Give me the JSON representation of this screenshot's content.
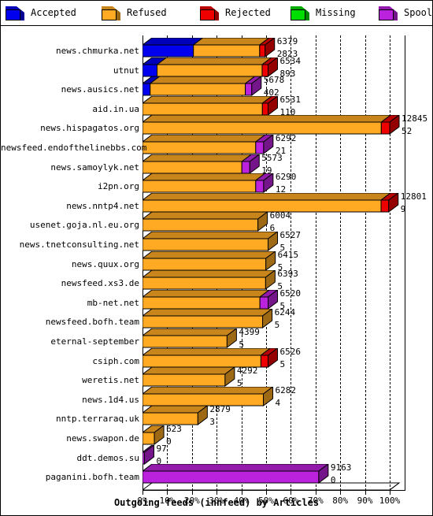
{
  "legend": {
    "items": [
      {
        "label": "Accepted",
        "color": "#0000ee",
        "icon": "cube-icon"
      },
      {
        "label": "Refused",
        "color": "#ffaa22",
        "icon": "cube-icon"
      },
      {
        "label": "Rejected",
        "color": "#ee0000",
        "icon": "cube-icon"
      },
      {
        "label": "Missing",
        "color": "#00dd00",
        "icon": "cube-icon"
      },
      {
        "label": "Spooled",
        "color": "#bb22dd",
        "icon": "cube-icon"
      }
    ]
  },
  "chart_data": {
    "type": "bar",
    "orientation": "horizontal",
    "stacked": true,
    "title": "Outgoing feeds (innfeed) by Articles",
    "xlabel": "Outgoing feeds (innfeed) by Articles",
    "ylabel": "",
    "xlim": [
      0,
      100
    ],
    "xunit": "%",
    "grid": true,
    "legend_position": "top",
    "xticks": [
      "0%",
      "10%",
      "20%",
      "30%",
      "40%",
      "50%",
      "60%",
      "70%",
      "80%",
      "90%",
      "100%"
    ],
    "xtick_values": [
      0,
      10,
      20,
      30,
      40,
      50,
      60,
      70,
      80,
      90,
      100
    ],
    "series": [
      {
        "name": "Accepted",
        "color": "#0000ee"
      },
      {
        "name": "Refused",
        "color": "#ffaa22"
      },
      {
        "name": "Rejected",
        "color": "#ee0000"
      },
      {
        "name": "Missing",
        "color": "#00dd00"
      },
      {
        "name": "Spooled",
        "color": "#bb22dd"
      }
    ],
    "categories": [
      "news.chmurka.net",
      "utnut",
      "news.ausics.net",
      "aid.in.ua",
      "news.hispagatos.org",
      "newsfeed.endofthelinebbs.com",
      "news.samoylyk.net",
      "i2pn.org",
      "news.nntp4.net",
      "usenet.goja.nl.eu.org",
      "news.tnetconsulting.net",
      "news.quux.org",
      "newsfeed.xs3.de",
      "mb-net.net",
      "newsfeed.bofh.team",
      "eternal-september",
      "csiph.com",
      "weretis.net",
      "news.1d4.us",
      "nntp.terraraq.uk",
      "news.swapon.de",
      "ddt.demos.su",
      "paganini.bofh.team"
    ],
    "rows": [
      {
        "label": "news.chmurka.net",
        "top_value": "6379",
        "bottom_value": "2823",
        "total_pct": 49.6,
        "segments": [
          {
            "series": "Accepted",
            "pct": 20.6
          },
          {
            "series": "Refused",
            "pct": 26.8
          },
          {
            "series": "Rejected",
            "pct": 2.2
          }
        ]
      },
      {
        "label": "utnut",
        "top_value": "6534",
        "bottom_value": "893",
        "total_pct": 50.8,
        "segments": [
          {
            "series": "Accepted",
            "pct": 5.9
          },
          {
            "series": "Refused",
            "pct": 42.5
          },
          {
            "series": "Rejected",
            "pct": 2.4
          }
        ]
      },
      {
        "label": "news.ausics.net",
        "top_value": "5678",
        "bottom_value": "402",
        "total_pct": 44.2,
        "segments": [
          {
            "series": "Accepted",
            "pct": 3.1
          },
          {
            "series": "Refused",
            "pct": 38.5
          },
          {
            "series": "Spooled",
            "pct": 2.6
          }
        ]
      },
      {
        "label": "aid.in.ua",
        "top_value": "6531",
        "bottom_value": "110",
        "total_pct": 50.8,
        "segments": [
          {
            "series": "Refused",
            "pct": 48.5
          },
          {
            "series": "Rejected",
            "pct": 2.3
          }
        ]
      },
      {
        "label": "news.hispagatos.org",
        "top_value": "12845",
        "bottom_value": "52",
        "total_pct": 100.0,
        "segments": [
          {
            "series": "Refused",
            "pct": 96.6
          },
          {
            "series": "Rejected",
            "pct": 3.4
          }
        ]
      },
      {
        "label": "newsfeed.endofthelinebbs.com",
        "top_value": "6292",
        "bottom_value": "21",
        "total_pct": 49.0,
        "segments": [
          {
            "series": "Refused",
            "pct": 45.8
          },
          {
            "series": "Spooled",
            "pct": 3.2
          }
        ]
      },
      {
        "label": "news.samoylyk.net",
        "top_value": "5573",
        "bottom_value": "19",
        "total_pct": 43.4,
        "segments": [
          {
            "series": "Refused",
            "pct": 40.2
          },
          {
            "series": "Spooled",
            "pct": 3.2
          }
        ]
      },
      {
        "label": "i2pn.org",
        "top_value": "6290",
        "bottom_value": "12",
        "total_pct": 49.0,
        "segments": [
          {
            "series": "Refused",
            "pct": 45.8
          },
          {
            "series": "Spooled",
            "pct": 3.2
          }
        ]
      },
      {
        "label": "news.nntp4.net",
        "top_value": "12801",
        "bottom_value": "9",
        "total_pct": 99.6,
        "segments": [
          {
            "series": "Refused",
            "pct": 96.5
          },
          {
            "series": "Rejected",
            "pct": 3.1
          }
        ]
      },
      {
        "label": "usenet.goja.nl.eu.org",
        "top_value": "6004",
        "bottom_value": "6",
        "total_pct": 46.7,
        "segments": [
          {
            "series": "Refused",
            "pct": 46.7
          }
        ]
      },
      {
        "label": "news.tnetconsulting.net",
        "top_value": "6527",
        "bottom_value": "5",
        "total_pct": 50.8,
        "segments": [
          {
            "series": "Refused",
            "pct": 50.8
          }
        ]
      },
      {
        "label": "news.quux.org",
        "top_value": "6415",
        "bottom_value": "5",
        "total_pct": 49.9,
        "segments": [
          {
            "series": "Refused",
            "pct": 49.9
          }
        ]
      },
      {
        "label": "newsfeed.xs3.de",
        "top_value": "6393",
        "bottom_value": "5",
        "total_pct": 49.8,
        "segments": [
          {
            "series": "Refused",
            "pct": 49.8
          }
        ]
      },
      {
        "label": "mb-net.net",
        "top_value": "6520",
        "bottom_value": "5",
        "total_pct": 50.8,
        "segments": [
          {
            "series": "Refused",
            "pct": 47.5
          },
          {
            "series": "Spooled",
            "pct": 3.3
          }
        ]
      },
      {
        "label": "newsfeed.bofh.team",
        "top_value": "6244",
        "bottom_value": "5",
        "total_pct": 48.6,
        "segments": [
          {
            "series": "Refused",
            "pct": 48.6
          }
        ]
      },
      {
        "label": "eternal-september",
        "top_value": "4399",
        "bottom_value": "5",
        "total_pct": 34.2,
        "segments": [
          {
            "series": "Refused",
            "pct": 34.2
          }
        ]
      },
      {
        "label": "csiph.com",
        "top_value": "6526",
        "bottom_value": "5",
        "total_pct": 50.8,
        "segments": [
          {
            "series": "Refused",
            "pct": 47.9
          },
          {
            "series": "Rejected",
            "pct": 2.9
          }
        ]
      },
      {
        "label": "weretis.net",
        "top_value": "4292",
        "bottom_value": "5",
        "total_pct": 33.4,
        "segments": [
          {
            "series": "Refused",
            "pct": 33.4
          }
        ]
      },
      {
        "label": "news.1d4.us",
        "top_value": "6282",
        "bottom_value": "4",
        "total_pct": 48.9,
        "segments": [
          {
            "series": "Refused",
            "pct": 48.9
          }
        ]
      },
      {
        "label": "nntp.terraraq.uk",
        "top_value": "2879",
        "bottom_value": "3",
        "total_pct": 22.4,
        "segments": [
          {
            "series": "Refused",
            "pct": 22.4
          }
        ]
      },
      {
        "label": "news.swapon.de",
        "top_value": "623",
        "bottom_value": "0",
        "total_pct": 4.8,
        "segments": [
          {
            "series": "Refused",
            "pct": 4.8
          }
        ]
      },
      {
        "label": "ddt.demos.su",
        "top_value": "97",
        "bottom_value": "0",
        "total_pct": 0.8,
        "segments": [
          {
            "series": "Spooled",
            "pct": 0.8
          }
        ]
      },
      {
        "label": "paganini.bofh.team",
        "top_value": "9163",
        "bottom_value": "0",
        "total_pct": 71.3,
        "segments": [
          {
            "series": "Spooled",
            "pct": 71.3
          }
        ]
      }
    ]
  }
}
